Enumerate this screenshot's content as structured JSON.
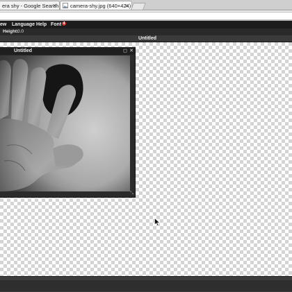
{
  "browser": {
    "tabs": [
      {
        "label": "era shy - Google Search"
      },
      {
        "label": "camera-shy.jpg (640×424)"
      }
    ],
    "colors": {
      "chrome": "#cfcfcf",
      "menubar": "#1c1c1c"
    }
  },
  "app": {
    "menu": [
      {
        "label": "ew"
      },
      {
        "label": "Language"
      },
      {
        "label": "Help"
      },
      {
        "label": "Font",
        "badge": "4"
      }
    ],
    "toolbar": {
      "height_label": "Height:",
      "height_value": "0.0"
    },
    "document_title": "Untitled"
  },
  "image_window": {
    "title": "Untitled",
    "buttons": [
      "maximize-icon",
      "close-icon"
    ],
    "content": "grayscale photo of a raised hand"
  }
}
